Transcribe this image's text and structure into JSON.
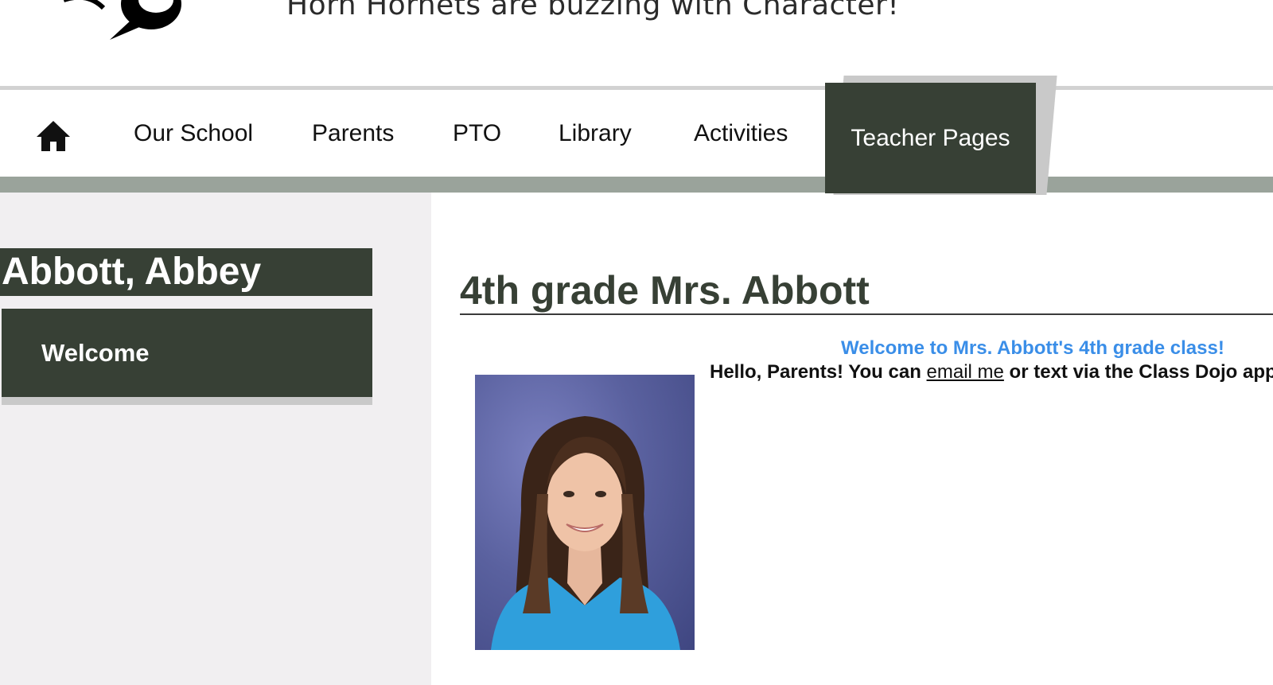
{
  "header": {
    "tagline": "Horn Hornets are buzzing with Character!"
  },
  "nav": {
    "home_icon": "home-icon",
    "items": [
      {
        "label": "Our School"
      },
      {
        "label": "Parents"
      },
      {
        "label": "PTO"
      },
      {
        "label": "Library"
      },
      {
        "label": "Activities"
      },
      {
        "label": "Teacher Pages"
      }
    ],
    "active_item": "Teacher Pages"
  },
  "sidebar": {
    "teacher_name": "Abbott, Abbey",
    "menu": [
      {
        "label": "Welcome"
      }
    ]
  },
  "main": {
    "title": "4th grade Mrs. Abbott",
    "welcome": "Welcome to Mrs. Abbott's 4th grade class!",
    "hello_prefix": "Hello, Parents! You can ",
    "email_link": "email me",
    "hello_suffix": " or text via the Class Dojo app."
  },
  "colors": {
    "accent_dark_green": "#374035",
    "nav_band": "#9aa39b",
    "sidebar_bg": "#f1eff1",
    "link_blue": "#3a8ee8"
  }
}
